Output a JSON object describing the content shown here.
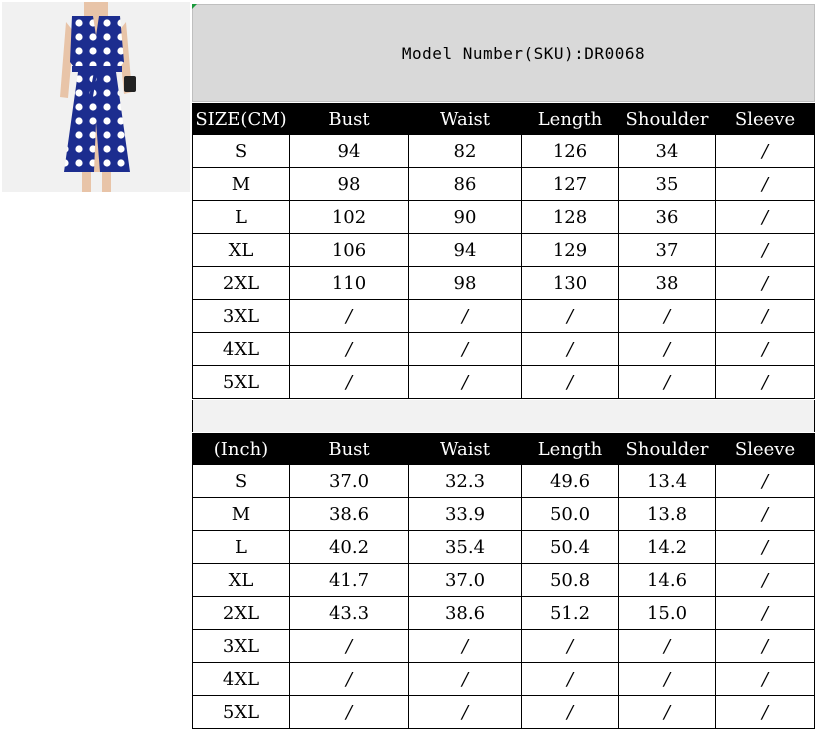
{
  "header": {
    "model_label": "Model Number(SKU):DR0068"
  },
  "cm_table": {
    "columns": [
      "SIZE(CM)",
      "Bust",
      "Waist",
      "Length",
      "Shoulder",
      "Sleeve"
    ],
    "rows": [
      [
        "S",
        "94",
        "82",
        "126",
        "34",
        "/"
      ],
      [
        "M",
        "98",
        "86",
        "127",
        "35",
        "/"
      ],
      [
        "L",
        "102",
        "90",
        "128",
        "36",
        "/"
      ],
      [
        "XL",
        "106",
        "94",
        "129",
        "37",
        "/"
      ],
      [
        "2XL",
        "110",
        "98",
        "130",
        "38",
        "/"
      ],
      [
        "3XL",
        "/",
        "/",
        "/",
        "/",
        "/"
      ],
      [
        "4XL",
        "/",
        "/",
        "/",
        "/",
        "/"
      ],
      [
        "5XL",
        "/",
        "/",
        "/",
        "/",
        "/"
      ]
    ]
  },
  "inch_table": {
    "columns": [
      "(Inch)",
      "Bust",
      "Waist",
      "Length",
      "Shoulder",
      "Sleeve"
    ],
    "rows": [
      [
        "S",
        "37.0",
        "32.3",
        "49.6",
        "13.4",
        "/"
      ],
      [
        "M",
        "38.6",
        "33.9",
        "50.0",
        "13.8",
        "/"
      ],
      [
        "L",
        "40.2",
        "35.4",
        "50.4",
        "14.2",
        "/"
      ],
      [
        "XL",
        "41.7",
        "37.0",
        "50.8",
        "14.6",
        "/"
      ],
      [
        "2XL",
        "43.3",
        "38.6",
        "51.2",
        "15.0",
        "/"
      ],
      [
        "3XL",
        "/",
        "/",
        "/",
        "/",
        "/"
      ],
      [
        "4XL",
        "/",
        "/",
        "/",
        "/",
        "/"
      ],
      [
        "5XL",
        "/",
        "/",
        "/",
        "/",
        "/"
      ]
    ]
  }
}
